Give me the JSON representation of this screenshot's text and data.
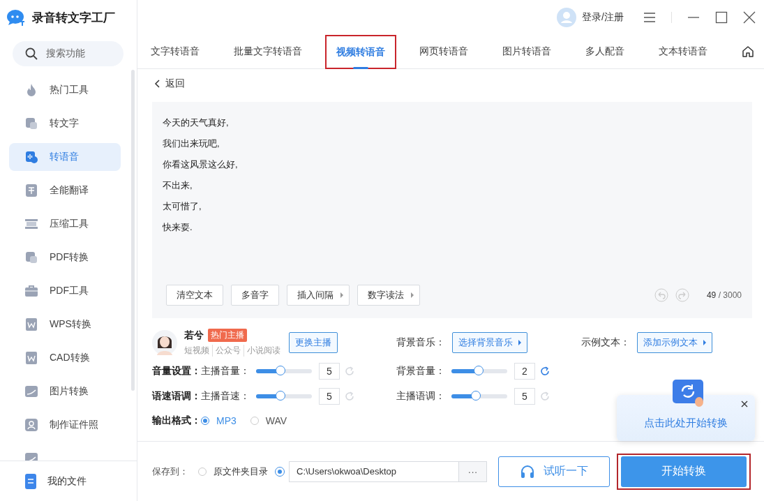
{
  "app": {
    "title": "录音转文字工厂"
  },
  "sidebar": {
    "search": {
      "placeholder": "搜索功能"
    },
    "items": [
      {
        "label": "热门工具",
        "selected": false
      },
      {
        "label": "转文字",
        "selected": false
      },
      {
        "label": "转语音",
        "selected": true
      },
      {
        "label": "全能翻译",
        "selected": false
      },
      {
        "label": "压缩工具",
        "selected": false
      },
      {
        "label": "PDF转换",
        "selected": false
      },
      {
        "label": "PDF工具",
        "selected": false
      },
      {
        "label": "WPS转换",
        "selected": false
      },
      {
        "label": "CAD转换",
        "selected": false
      },
      {
        "label": "图片转换",
        "selected": false
      },
      {
        "label": "制作证件照",
        "selected": false
      }
    ],
    "footer_item": {
      "label": "我的文件"
    }
  },
  "header": {
    "login": "登录/注册"
  },
  "tabs": [
    {
      "label": "文字转语音",
      "selected": false,
      "highlighted": false
    },
    {
      "label": "批量文字转语音",
      "selected": false,
      "highlighted": false
    },
    {
      "label": "视频转语音",
      "selected": true,
      "highlighted": true
    },
    {
      "label": "网页转语音",
      "selected": false,
      "highlighted": false
    },
    {
      "label": "图片转语音",
      "selected": false,
      "highlighted": false
    },
    {
      "label": "多人配音",
      "selected": false,
      "highlighted": false
    },
    {
      "label": "文本转语音",
      "selected": false,
      "highlighted": false
    }
  ],
  "back": "返回",
  "editor": {
    "lines": [
      "今天的天气真好,",
      "我们出来玩吧,",
      "你看这风景这么好,",
      "不出来,",
      "太可惜了,",
      "快来耍."
    ],
    "tools": [
      {
        "label": "清空文本",
        "has_menu": false
      },
      {
        "label": "多音字",
        "has_menu": false
      },
      {
        "label": "插入间隔",
        "has_menu": true
      },
      {
        "label": "数字读法",
        "has_menu": true
      }
    ],
    "count": "49",
    "limit": "/ 3000"
  },
  "anchor": {
    "name": "若兮",
    "badge": "热门主播",
    "tags": [
      "短视频",
      "公众号",
      "小说阅读"
    ],
    "change_button": "更换主播"
  },
  "bgm": {
    "label": "背景音乐：",
    "button": "选择背景音乐"
  },
  "sample": {
    "label": "示例文本：",
    "button": "添加示例文本"
  },
  "settings": [
    {
      "group": "音量设置：",
      "sliders": [
        {
          "label": "主播音量：",
          "level": 0.44,
          "value": "5",
          "reset_active": false
        },
        {
          "label": "背景音量：",
          "level": 0.49,
          "value": "2",
          "reset_active": true
        }
      ]
    },
    {
      "group": "语速语调：",
      "sliders": [
        {
          "label": "主播音速：",
          "level": 0.44,
          "value": "5",
          "reset_active": false
        },
        {
          "label": "主播语调：",
          "level": 0.44,
          "value": "5",
          "reset_active": false
        }
      ]
    }
  ],
  "format": {
    "label": "输出格式：",
    "options": [
      {
        "label": "MP3",
        "selected": true
      },
      {
        "label": "WAV",
        "selected": false
      }
    ]
  },
  "save": {
    "label": "保存到：",
    "folder_option": {
      "label": "原文件夹目录",
      "selected": false
    },
    "path_option": {
      "value": "C:\\Users\\okwoa\\Desktop",
      "selected": true
    },
    "browse": "···"
  },
  "preview_button": "试听一下",
  "start_button": {
    "label": "开始转换",
    "highlighted": true
  },
  "tooltip": {
    "text": "点击此处开始转换"
  }
}
